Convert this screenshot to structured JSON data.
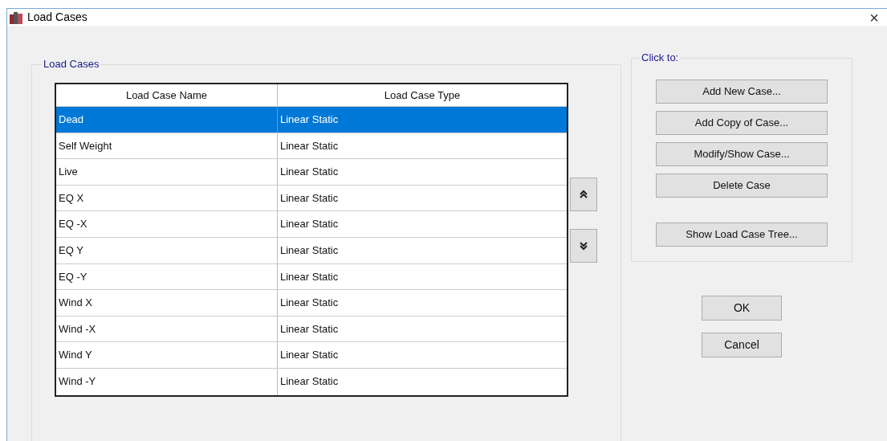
{
  "window": {
    "title": "Load Cases",
    "close": "×"
  },
  "load_cases": {
    "title": "Load Cases",
    "columns": [
      "Load Case Name",
      "Load Case Type"
    ],
    "rows": [
      {
        "name": "Dead",
        "type": "Linear Static",
        "selected": true
      },
      {
        "name": "Self Weight",
        "type": "Linear Static",
        "selected": false
      },
      {
        "name": "Live",
        "type": "Linear Static",
        "selected": false
      },
      {
        "name": "EQ X",
        "type": "Linear Static",
        "selected": false
      },
      {
        "name": "EQ -X",
        "type": "Linear Static",
        "selected": false
      },
      {
        "name": "EQ Y",
        "type": "Linear Static",
        "selected": false
      },
      {
        "name": "EQ -Y",
        "type": "Linear Static",
        "selected": false
      },
      {
        "name": "Wind X",
        "type": "Linear Static",
        "selected": false
      },
      {
        "name": "Wind -X",
        "type": "Linear Static",
        "selected": false
      },
      {
        "name": "Wind Y",
        "type": "Linear Static",
        "selected": false
      },
      {
        "name": "Wind -Y",
        "type": "Linear Static",
        "selected": false
      }
    ]
  },
  "click_to": {
    "title": "Click to:",
    "buttons": [
      "Add New Case...",
      "Add Copy of Case...",
      "Modify/Show Case...",
      "Delete Case"
    ],
    "tree_button": "Show Load Case Tree..."
  },
  "buttons": [
    "OK",
    "Cancel"
  ]
}
